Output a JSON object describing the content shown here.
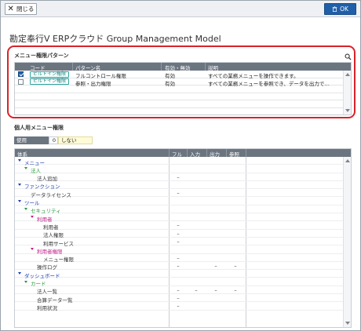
{
  "toolbar": {
    "close_label": "閉じる",
    "ok_label": "OK"
  },
  "app_title": "勘定奉行V ERPクラウド Group Management Model",
  "pattern_section": {
    "title": "メニュー権限パターン",
    "columns": [
      "コード",
      "パターン名",
      "有効・無効",
      "説明"
    ],
    "rows": [
      {
        "checked": true,
        "code": "ビルトイン権限",
        "name": "フルコントロール権限",
        "status": "有効",
        "desc": "すべての業務メニューを操作できます。"
      },
      {
        "checked": false,
        "code": "ビルトイン権限",
        "name": "参照・出力権限",
        "status": "有効",
        "desc": "すべての業務メニューを参照でき、データを出力で…"
      }
    ]
  },
  "personal_section": {
    "title": "個人用メニュー権限",
    "use_label": "使用",
    "use_value": "0",
    "use_text": "しない"
  },
  "tree": {
    "columns": [
      "体系",
      "フル",
      "入力",
      "出力",
      "参照"
    ],
    "rows": [
      {
        "label": "メニュー",
        "level": 0,
        "color": "blue",
        "twisty": true,
        "vals": [
          "",
          "",
          "",
          ""
        ]
      },
      {
        "label": "法人",
        "level": 1,
        "color": "green",
        "twisty": true,
        "vals": [
          "",
          "",
          "",
          ""
        ]
      },
      {
        "label": "法人追加",
        "level": 2,
        "color": "dark",
        "twisty": false,
        "vals": [
          "–",
          "",
          "",
          ""
        ]
      },
      {
        "label": "ファンクション",
        "level": 0,
        "color": "blue",
        "twisty": true,
        "vals": [
          "",
          "",
          "",
          ""
        ]
      },
      {
        "label": "データライセンス",
        "level": 1,
        "color": "dark",
        "twisty": false,
        "vals": [
          "–",
          "",
          "",
          ""
        ]
      },
      {
        "label": "ツール",
        "level": 0,
        "color": "blue",
        "twisty": true,
        "vals": [
          "",
          "",
          "",
          ""
        ]
      },
      {
        "label": "セキュリティ",
        "level": 1,
        "color": "green",
        "twisty": true,
        "vals": [
          "",
          "",
          "",
          ""
        ]
      },
      {
        "label": "利用者",
        "level": 2,
        "color": "pink",
        "twisty": true,
        "vals": [
          "",
          "",
          "",
          ""
        ]
      },
      {
        "label": "利用者",
        "level": 3,
        "color": "dark",
        "twisty": false,
        "vals": [
          "–",
          "",
          "",
          ""
        ]
      },
      {
        "label": "法人権限",
        "level": 3,
        "color": "dark",
        "twisty": false,
        "vals": [
          "–",
          "",
          "",
          ""
        ]
      },
      {
        "label": "利用サービス",
        "level": 3,
        "color": "dark",
        "twisty": false,
        "vals": [
          "–",
          "",
          "",
          ""
        ]
      },
      {
        "label": "利用者権限",
        "level": 2,
        "color": "pink",
        "twisty": true,
        "vals": [
          "",
          "",
          "",
          ""
        ]
      },
      {
        "label": "メニュー権限",
        "level": 3,
        "color": "dark",
        "twisty": false,
        "vals": [
          "–",
          "",
          "",
          ""
        ]
      },
      {
        "label": "操作ログ",
        "level": 2,
        "color": "dark",
        "twisty": false,
        "vals": [
          "–",
          "",
          "–",
          "–"
        ]
      },
      {
        "label": "ダッシュボード",
        "level": 0,
        "color": "blue",
        "twisty": true,
        "vals": [
          "",
          "",
          "",
          ""
        ]
      },
      {
        "label": "カード",
        "level": 1,
        "color": "green",
        "twisty": true,
        "vals": [
          "",
          "",
          "",
          ""
        ]
      },
      {
        "label": "法人一覧",
        "level": 2,
        "color": "dark",
        "twisty": false,
        "vals": [
          "–",
          "–",
          "–",
          "–"
        ]
      },
      {
        "label": "合算データ一覧",
        "level": 2,
        "color": "dark",
        "twisty": false,
        "vals": [
          "–",
          "",
          "",
          ""
        ]
      },
      {
        "label": "利用状況",
        "level": 2,
        "color": "dark",
        "twisty": false,
        "vals": [
          "–",
          "",
          "",
          ""
        ]
      }
    ]
  },
  "icons": {
    "close": "close-icon",
    "ok": "trash-icon",
    "search": "search-icon"
  },
  "colors": {
    "accent": "#1f5fa8",
    "highlight_frame": "#d9232a",
    "header": "#6b7580",
    "badge": "#2fa5a0"
  }
}
